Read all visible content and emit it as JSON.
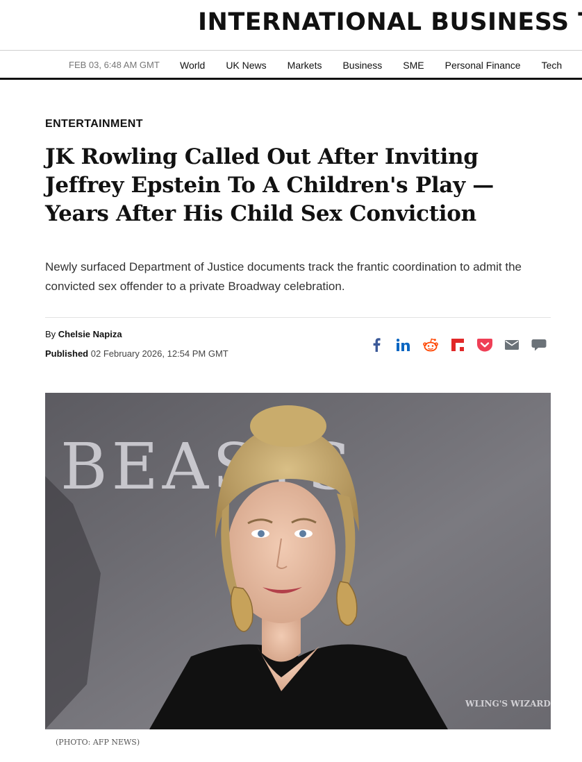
{
  "masthead": {
    "logo": "INTERNATIONAL BUSINESS TIMES"
  },
  "nav": {
    "date": "FEB 03, 6:48 AM GMT",
    "items": [
      "World",
      "UK News",
      "Markets",
      "Business",
      "SME",
      "Personal Finance",
      "Tech"
    ]
  },
  "article": {
    "kicker": "ENTERTAINMENT",
    "headline": "JK Rowling Called Out After Inviting Jeffrey Epstein To A Children's Play — Years After His Child Sex Conviction",
    "standfirst": "Newly surfaced Department of Justice documents track the frantic coordination to admit the convicted sex offender to a private Broadway celebration.",
    "byline_prefix": "By",
    "author": "Chelsie Napiza",
    "published_label": "Published",
    "published_date": "02 February 2026, 12:54 PM GMT"
  },
  "share": {
    "icons": [
      "facebook-icon",
      "linkedin-icon",
      "reddit-icon",
      "flipboard-icon",
      "pocket-icon",
      "email-icon",
      "comment-icon"
    ],
    "colors": {
      "facebook": "#3b5998",
      "linkedin": "#0a66c2",
      "reddit": "#ff4500",
      "flipboard": "#e12828",
      "pocket": "#ef3f56",
      "grey": "#6b7278"
    }
  },
  "hero": {
    "backdrop_text_1": "BEASTS",
    "backdrop_text_2": "WLING'S WIZARD",
    "caption": "(PHOTO: AFP NEWS)"
  }
}
